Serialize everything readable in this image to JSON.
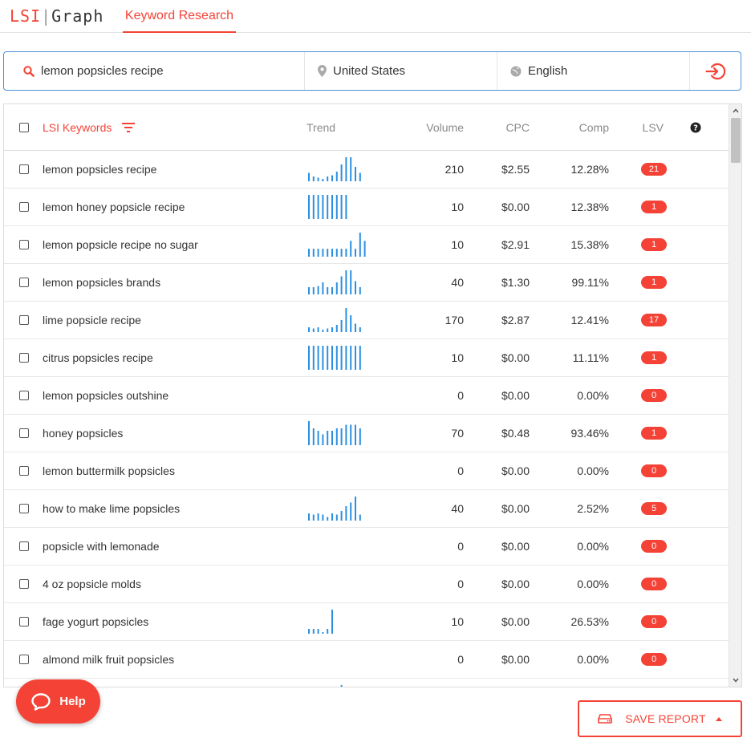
{
  "app": {
    "logo_lsi": "LSI",
    "logo_sep": "|",
    "logo_graph": "Graph",
    "nav_tab": "Keyword Research"
  },
  "search": {
    "keyword": "lemon popsicles recipe",
    "location": "United States",
    "language": "English"
  },
  "table": {
    "headers": {
      "keywords": "LSI Keywords",
      "trend": "Trend",
      "volume": "Volume",
      "cpc": "CPC",
      "comp": "Comp",
      "lsv": "LSV"
    },
    "rows": [
      {
        "keyword": "lemon popsicles recipe",
        "volume": "210",
        "cpc": "$2.55",
        "comp": "12.28%",
        "lsv": "21",
        "trend": [
          0.35,
          0.2,
          0.15,
          0.1,
          0.2,
          0.25,
          0.4,
          0.7,
          1.0,
          1.0,
          0.6,
          0.35
        ]
      },
      {
        "keyword": "lemon honey popsicle recipe",
        "volume": "10",
        "cpc": "$0.00",
        "comp": "12.38%",
        "lsv": "1",
        "trend": [
          1.0,
          1.0,
          1.0,
          1.0,
          1.0,
          1.0,
          1.0,
          1.0,
          1.0
        ]
      },
      {
        "keyword": "lemon popsicle recipe no sugar",
        "volume": "10",
        "cpc": "$2.91",
        "comp": "15.38%",
        "lsv": "1",
        "trend": [
          0.33,
          0.33,
          0.33,
          0.33,
          0.33,
          0.33,
          0.33,
          0.33,
          0.33,
          0.66,
          0.33,
          1.0,
          0.66
        ]
      },
      {
        "keyword": "lemon popsicles brands",
        "volume": "40",
        "cpc": "$1.30",
        "comp": "99.11%",
        "lsv": "1",
        "trend": [
          0.3,
          0.3,
          0.35,
          0.5,
          0.3,
          0.3,
          0.5,
          0.75,
          1.0,
          1.0,
          0.55,
          0.3
        ]
      },
      {
        "keyword": "lime popsicle recipe",
        "volume": "170",
        "cpc": "$2.87",
        "comp": "12.41%",
        "lsv": "17",
        "trend": [
          0.2,
          0.15,
          0.2,
          0.1,
          0.15,
          0.2,
          0.3,
          0.5,
          1.0,
          0.7,
          0.35,
          0.2
        ]
      },
      {
        "keyword": "citrus popsicles recipe",
        "volume": "10",
        "cpc": "$0.00",
        "comp": "11.11%",
        "lsv": "1",
        "trend": [
          1.0,
          1.0,
          1.0,
          1.0,
          1.0,
          1.0,
          1.0,
          1.0,
          1.0,
          1.0,
          1.0,
          1.0
        ]
      },
      {
        "keyword": "lemon popsicles outshine",
        "volume": "0",
        "cpc": "$0.00",
        "comp": "0.00%",
        "lsv": "0",
        "trend": []
      },
      {
        "keyword": "honey popsicles",
        "volume": "70",
        "cpc": "$0.48",
        "comp": "93.46%",
        "lsv": "1",
        "trend": [
          1.0,
          0.7,
          0.6,
          0.45,
          0.6,
          0.6,
          0.7,
          0.7,
          0.85,
          0.85,
          0.85,
          0.7
        ]
      },
      {
        "keyword": "lemon buttermilk popsicles",
        "volume": "0",
        "cpc": "$0.00",
        "comp": "0.00%",
        "lsv": "0",
        "trend": []
      },
      {
        "keyword": "how to make lime popsicles",
        "volume": "40",
        "cpc": "$0.00",
        "comp": "2.52%",
        "lsv": "5",
        "trend": [
          0.3,
          0.25,
          0.3,
          0.25,
          0.15,
          0.3,
          0.25,
          0.4,
          0.6,
          0.75,
          1.0,
          0.25
        ]
      },
      {
        "keyword": "popsicle with lemonade",
        "volume": "0",
        "cpc": "$0.00",
        "comp": "0.00%",
        "lsv": "0",
        "trend": []
      },
      {
        "keyword": "4 oz popsicle molds",
        "volume": "0",
        "cpc": "$0.00",
        "comp": "0.00%",
        "lsv": "0",
        "trend": []
      },
      {
        "keyword": "fage yogurt popsicles",
        "volume": "10",
        "cpc": "$0.00",
        "comp": "26.53%",
        "lsv": "0",
        "trend": [
          0.2,
          0.2,
          0.2,
          0.0,
          0.2,
          1.0
        ]
      },
      {
        "keyword": "almond milk fruit popsicles",
        "volume": "0",
        "cpc": "$0.00",
        "comp": "0.00%",
        "lsv": "0",
        "trend": []
      },
      {
        "keyword": "",
        "volume": "",
        "cpc": "",
        "comp": "",
        "lsv": "",
        "trend": [
          0.0,
          0.0,
          0.0,
          0.0,
          0.0,
          0.0,
          0.0,
          1.0
        ]
      }
    ]
  },
  "buttons": {
    "help": "Help",
    "save_report": "SAVE REPORT"
  },
  "colors": {
    "accent": "#f44336",
    "trend_bar": "#2b8fe0",
    "search_border": "#4a90d9"
  },
  "icons": {
    "search": "search-icon",
    "location": "map-pin-icon",
    "language": "globe-icon",
    "submit": "sign-in-icon",
    "filter": "filter-icon",
    "help_column": "question-circle-icon",
    "help_button": "chat-bubble-icon",
    "save": "hard-drive-icon",
    "caret": "caret-up-icon"
  }
}
